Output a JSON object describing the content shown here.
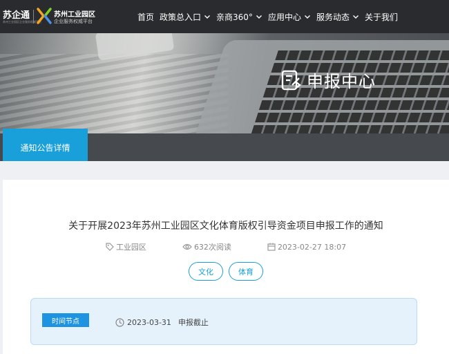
{
  "header": {
    "logo_left": "苏企通",
    "logo_left_sub": "苏州工业园区企业服务权威平台",
    "logo_right": "苏州工业园区",
    "logo_right_sub": "企业服务权威平台",
    "nav": [
      {
        "label": "首页",
        "has_dropdown": false
      },
      {
        "label": "政策总入口",
        "has_dropdown": true
      },
      {
        "label": "亲商360°",
        "has_dropdown": true
      },
      {
        "label": "应用中心",
        "has_dropdown": true
      },
      {
        "label": "服务动态",
        "has_dropdown": true
      },
      {
        "label": "关于我们",
        "has_dropdown": false
      }
    ]
  },
  "banner": {
    "title": "申报中心",
    "icon": "document-edit-icon"
  },
  "tabs": {
    "active_label": "通知公告详情"
  },
  "article": {
    "title": "关于开展2023年苏州工业园区文化体育版权引导资金项目申报工作的通知",
    "source": "工业园区",
    "views": "632次阅读",
    "date": "2023-02-27 18:07",
    "tags": [
      "文化",
      "体育"
    ]
  },
  "timeline": {
    "label": "时间节点",
    "date": "2023-03-31",
    "desc": "申报截止"
  },
  "colors": {
    "accent": "#199fd9",
    "topbar": "#2a2b2e",
    "tabstrip": "#46494d",
    "timebox_bg": "#e6f2fb"
  }
}
